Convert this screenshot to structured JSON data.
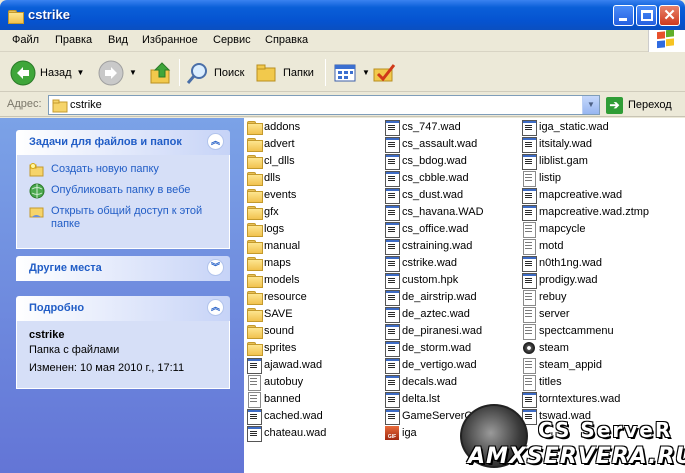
{
  "window": {
    "title": "cstrike",
    "icon": "folder-icon"
  },
  "menu": [
    "Файл",
    "Правка",
    "Вид",
    "Избранное",
    "Сервис",
    "Справка"
  ],
  "toolbar": {
    "back_label": "Назад",
    "search_label": "Поиск",
    "folders_label": "Папки"
  },
  "address": {
    "label": "Адрес:",
    "value": "cstrike",
    "go_label": "Переход"
  },
  "taskpane": {
    "tasks": {
      "title": "Задачи для файлов и папок",
      "items": [
        {
          "label": "Создать новую папку",
          "icon": "new-folder-icon"
        },
        {
          "label": "Опубликовать папку в вебе",
          "icon": "publish-web-icon"
        },
        {
          "label": "Открыть общий доступ к этой папке",
          "icon": "share-folder-icon"
        }
      ]
    },
    "other_places": {
      "title": "Другие места"
    },
    "details": {
      "title": "Подробно",
      "name": "cstrike",
      "type": "Папка с файлами",
      "modified": "Изменен: 10 мая 2010 г., 17:11"
    }
  },
  "files": {
    "col1": [
      {
        "name": "addons",
        "type": "folder"
      },
      {
        "name": "advert",
        "type": "folder"
      },
      {
        "name": "cl_dlls",
        "type": "folder"
      },
      {
        "name": "dlls",
        "type": "folder"
      },
      {
        "name": "events",
        "type": "folder"
      },
      {
        "name": "gfx",
        "type": "folder"
      },
      {
        "name": "logs",
        "type": "folder"
      },
      {
        "name": "manual",
        "type": "folder"
      },
      {
        "name": "maps",
        "type": "folder"
      },
      {
        "name": "models",
        "type": "folder"
      },
      {
        "name": "resource",
        "type": "folder"
      },
      {
        "name": "SAVE",
        "type": "folder"
      },
      {
        "name": "sound",
        "type": "folder"
      },
      {
        "name": "sprites",
        "type": "folder"
      },
      {
        "name": "ajawad.wad",
        "type": "wad"
      },
      {
        "name": "autobuy",
        "type": "txt"
      },
      {
        "name": "banned",
        "type": "txt"
      },
      {
        "name": "cached.wad",
        "type": "wad"
      },
      {
        "name": "chateau.wad",
        "type": "wad"
      }
    ],
    "col2": [
      {
        "name": "cs_747.wad",
        "type": "wad"
      },
      {
        "name": "cs_assault.wad",
        "type": "wad"
      },
      {
        "name": "cs_bdog.wad",
        "type": "wad"
      },
      {
        "name": "cs_cbble.wad",
        "type": "wad"
      },
      {
        "name": "cs_dust.wad",
        "type": "wad"
      },
      {
        "name": "cs_havana.WAD",
        "type": "wad"
      },
      {
        "name": "cs_office.wad",
        "type": "wad"
      },
      {
        "name": "cstraining.wad",
        "type": "wad"
      },
      {
        "name": "cstrike.wad",
        "type": "wad"
      },
      {
        "name": "custom.hpk",
        "type": "wad"
      },
      {
        "name": "de_airstrip.wad",
        "type": "wad"
      },
      {
        "name": "de_aztec.wad",
        "type": "wad"
      },
      {
        "name": "de_piranesi.wad",
        "type": "wad"
      },
      {
        "name": "de_storm.wad",
        "type": "wad"
      },
      {
        "name": "de_vertigo.wad",
        "type": "wad"
      },
      {
        "name": "decals.wad",
        "type": "wad"
      },
      {
        "name": "delta.lst",
        "type": "wad"
      },
      {
        "name": "GameServerCo",
        "type": "wad"
      },
      {
        "name": "iga",
        "type": "img"
      }
    ],
    "col3": [
      {
        "name": "iga_static.wad",
        "type": "wad"
      },
      {
        "name": "itsitaly.wad",
        "type": "wad"
      },
      {
        "name": "liblist.gam",
        "type": "wad"
      },
      {
        "name": "listip",
        "type": "txt"
      },
      {
        "name": "mapcreative.wad",
        "type": "wad"
      },
      {
        "name": "mapcreative.wad.ztmp",
        "type": "wad"
      },
      {
        "name": "mapcycle",
        "type": "txt"
      },
      {
        "name": "motd",
        "type": "txt"
      },
      {
        "name": "n0th1ng.wad",
        "type": "wad"
      },
      {
        "name": "prodigy.wad",
        "type": "wad"
      },
      {
        "name": "rebuy",
        "type": "txt"
      },
      {
        "name": "server",
        "type": "txt"
      },
      {
        "name": "spectcammenu",
        "type": "txt"
      },
      {
        "name": "steam",
        "type": "steam"
      },
      {
        "name": "steam_appid",
        "type": "txt"
      },
      {
        "name": "titles",
        "type": "txt"
      },
      {
        "name": "torntextures.wad",
        "type": "wad"
      },
      {
        "name": "tswad.wad",
        "type": "wad"
      }
    ]
  },
  "watermark": {
    "line1": "CS ServeR",
    "line2": "AMXSERVERA.RU"
  }
}
